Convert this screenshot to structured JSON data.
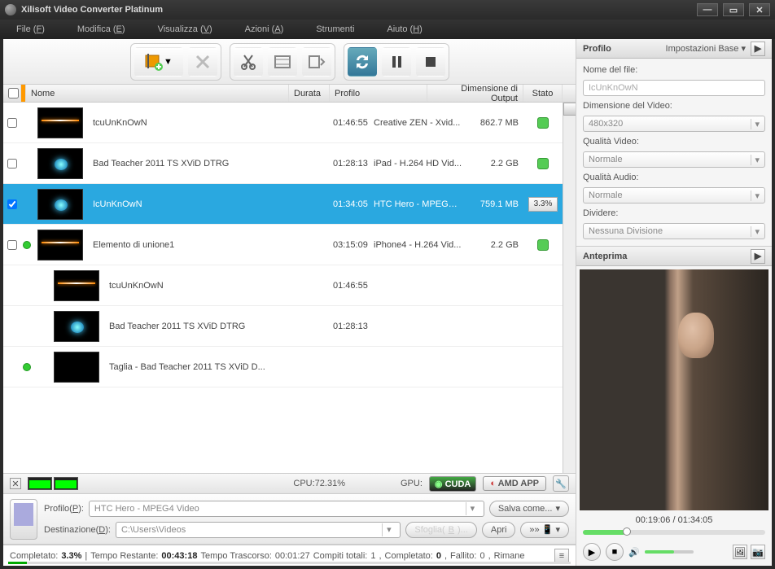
{
  "title": "Xilisoft Video Converter Platinum",
  "menu": {
    "file": "File (F)",
    "edit": "Modifica (E)",
    "view": "Visualizza (V)",
    "actions": "Azioni (A)",
    "tools": "Strumenti",
    "help": "Aiuto (H)"
  },
  "columns": {
    "name": "Nome",
    "duration": "Durata",
    "profile": "Profilo",
    "outsize": "Dimensione di Output",
    "status": "Stato"
  },
  "files": [
    {
      "checked": false,
      "thumb": "spark",
      "name": "tcuUnKnOwN",
      "duration": "01:46:55",
      "profile": "Creative ZEN - Xvid...",
      "size": "862.7 MB",
      "state": "ready"
    },
    {
      "checked": false,
      "thumb": "blob",
      "name": "Bad Teacher 2011 TS XViD DTRG",
      "duration": "01:28:13",
      "profile": "iPad - H.264 HD Vid...",
      "size": "2.2 GB",
      "state": "ready"
    },
    {
      "checked": true,
      "thumb": "blob",
      "name": "IcUnKnOwN",
      "duration": "01:34:05",
      "profile": "HTC Hero - MPEG4 ...",
      "size": "759.1 MB",
      "state": "3.3%",
      "selected": true
    },
    {
      "checked": false,
      "thumb": "spark",
      "name": "Elemento di unione1",
      "duration": "03:15:09",
      "profile": "iPhone4 - H.264 Vid...",
      "size": "2.2 GB",
      "state": "ready",
      "join": true
    }
  ],
  "subs": [
    {
      "thumb": "spark",
      "name": "tcuUnKnOwN",
      "duration": "01:46:55"
    },
    {
      "thumb": "blob",
      "name": "Bad Teacher 2011 TS XViD DTRG",
      "duration": "01:28:13"
    },
    {
      "thumb": "black",
      "name": "Taglia - Bad Teacher 2011 TS XViD D...",
      "duration": "",
      "join": true
    }
  ],
  "cpu": {
    "label": "CPU:72.31%"
  },
  "gpu": {
    "label": "GPU:",
    "cuda": "CUDA",
    "amd": "AMD APP"
  },
  "profileBar": {
    "profileLabel": "Profilo(P):",
    "profileValue": "HTC Hero - MPEG4 Video",
    "destLabel": "Destinazione(D):",
    "destValue": "C:\\Users\\Videos",
    "saveAs": "Salva come...",
    "browse": "Sfoglia(B)...",
    "open": "Apri"
  },
  "status": {
    "completedLabel": "Completato:",
    "completedVal": "3.3%",
    "remainingLabel": "Tempo Restante:",
    "remainingVal": "00:43:18",
    "elapsedLabel": "Tempo Trascorso:",
    "elapsedVal": "00:01:27",
    "tasksLabel": "Compiti totali:",
    "tasksVal": "1",
    "doneLabel": "Completato:",
    "doneVal": "0",
    "failLabel": "Fallito:",
    "failVal": "0",
    "leftLabel": "Rimane"
  },
  "rightPanel": {
    "profileHeader": "Profilo",
    "baseSettings": "Impostazioni Base",
    "filenameLabel": "Nome del file:",
    "filenameValue": "IcUnKnOwN",
    "videoSizeLabel": "Dimensione del Video:",
    "videoSizeValue": "480x320",
    "vqLabel": "Qualità Video:",
    "vqValue": "Normale",
    "aqLabel": "Qualità Audio:",
    "aqValue": "Normale",
    "splitLabel": "Dividere:",
    "splitValue": "Nessuna Divisione",
    "previewHeader": "Anteprima",
    "time": "00:19:06 / 01:34:05"
  }
}
